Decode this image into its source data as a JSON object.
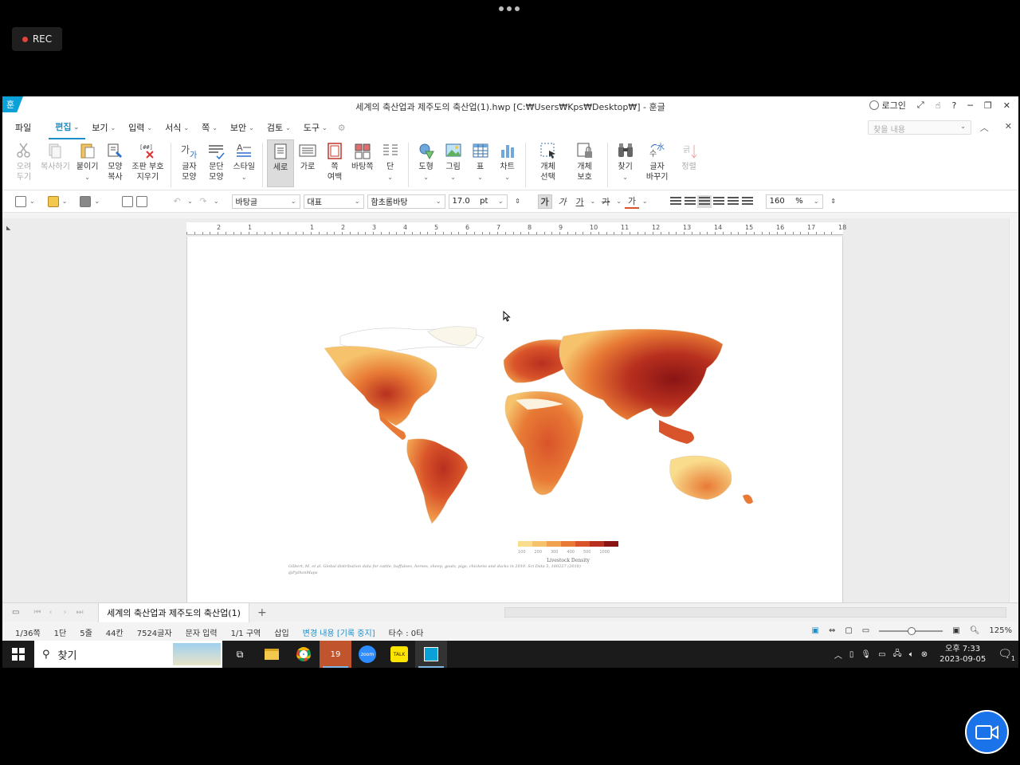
{
  "overlay": {
    "rec_label": "REC"
  },
  "window": {
    "title": "세계의 축산업과 제주도의 축산업(1).hwp [C:₩Users₩Kps₩Desktop₩] - 훈글",
    "login_label": "로그인"
  },
  "menu": {
    "file": "파일",
    "items": [
      "편집",
      "보기",
      "입력",
      "서식",
      "쪽",
      "보안",
      "검토",
      "도구"
    ],
    "search_placeholder": "찾을 내용"
  },
  "ribbon": {
    "cut": [
      "오려",
      "두기"
    ],
    "copy": "복사하기",
    "paste": "붙이기",
    "format_copy": [
      "모양",
      "복사"
    ],
    "clear_codes": [
      "조판 부호",
      "지우기"
    ],
    "char_shape": [
      "글자",
      "모양"
    ],
    "para_shape": [
      "문단",
      "모양"
    ],
    "style": "스타일",
    "portrait": "세로",
    "landscape": "가로",
    "margins": [
      "쪽",
      "여백"
    ],
    "page_border": "바탕쪽",
    "columns": "단",
    "shapes": "도형",
    "picture": "그림",
    "table": "표",
    "chart": "차트",
    "obj_select": [
      "개체",
      "선택"
    ],
    "obj_protect": [
      "개체",
      "보호"
    ],
    "find": "찾기",
    "replace": [
      "글자",
      "바꾸기"
    ],
    "sort": "정렬"
  },
  "format_bar": {
    "style": "바탕글",
    "font_type": "대표",
    "font": "함초롬바탕",
    "size": "17.0",
    "unit": "pt",
    "bold": "가",
    "italic": "가",
    "underline": "가",
    "strike": "가",
    "color": "가",
    "line_spacing": "160",
    "line_unit": "%"
  },
  "ruler": {
    "ticks": [
      "2",
      "1",
      "",
      "1",
      "2",
      "3",
      "4",
      "5",
      "6",
      "7",
      "8",
      "9",
      "10",
      "11",
      "12",
      "13",
      "14",
      "15",
      "16",
      "17",
      "18"
    ]
  },
  "figure": {
    "legend_title": "Livestock Density",
    "legend_colors": [
      "#f9dc8c",
      "#f6c26b",
      "#f2a24e",
      "#e87a35",
      "#d9542a",
      "#b8301f",
      "#8a1414"
    ],
    "legend_ticks": [
      "100",
      "200",
      "300",
      "400",
      "500",
      "1000",
      ""
    ],
    "citation_line1": "Gilbert, M. et al. Global distribution data for cattle, buffaloes, horses, sheep, goats, pigs, chickens and ducks in 2010. Sci Data 5, 180227 (2018)",
    "citation_line2": "@PythonMaps"
  },
  "doc_tab": {
    "label": "세계의 축산업과 제주도의 축산업(1)"
  },
  "status": {
    "page": "1/36쪽",
    "column": "1단",
    "line": "5줄",
    "col": "44칸",
    "chars": "7524글자",
    "mode": "문자 입력",
    "section": "1/1 구역",
    "insert": "삽입",
    "track_changes": "변경 내용 [기록 중지]",
    "keystrokes": "타수 : 0타",
    "zoom": "125%"
  },
  "taskbar": {
    "search_label": "찾기",
    "clock_time": "오후 7:33",
    "clock_date": "2023-09-05",
    "notification_count": "1"
  }
}
